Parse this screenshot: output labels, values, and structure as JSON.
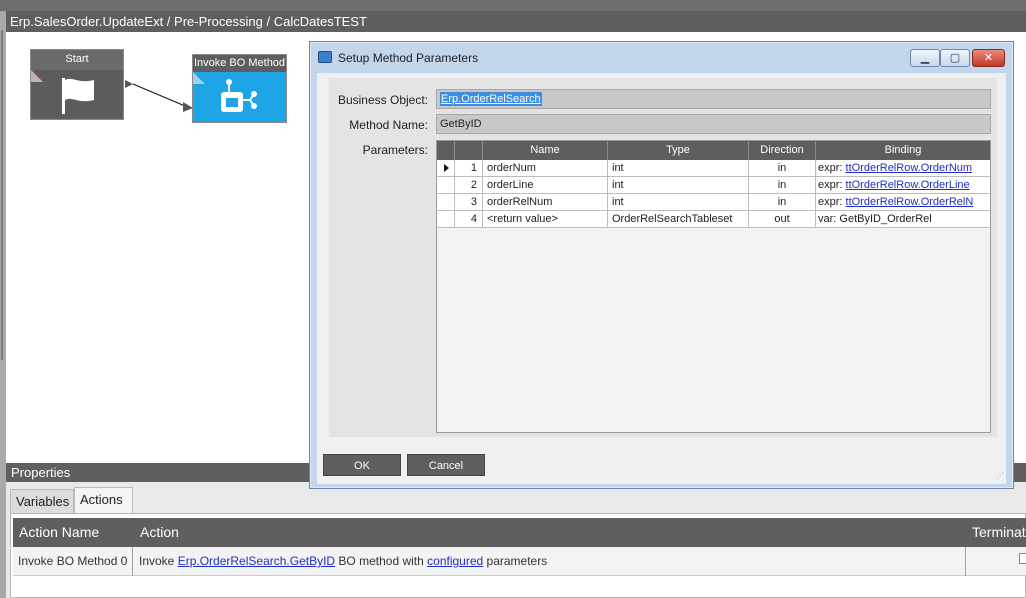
{
  "window": {
    "title": "Erp.SalesOrder.UpdateExt / Pre-Processing / CalcDatesTEST"
  },
  "canvas": {
    "start_node": {
      "label": "Start",
      "icon": "flag-icon"
    },
    "bo_node": {
      "label": "Invoke BO Method",
      "icon": "bo-method-icon"
    }
  },
  "dialog": {
    "title": "Setup Method Parameters",
    "business_object_label": "Business Object:",
    "business_object_value": "Erp.OrderRelSearch",
    "method_name_label": "Method Name:",
    "method_name_value": "GetByID",
    "parameters_label": "Parameters:",
    "columns": [
      "Name",
      "Type",
      "Direction",
      "Binding"
    ],
    "rows": [
      {
        "num": "1",
        "name": "orderNum",
        "type": "int",
        "direction": "in",
        "binding_prefix": "expr: ",
        "binding_link": "ttOrderRelRow.OrderNum"
      },
      {
        "num": "2",
        "name": "orderLine",
        "type": "int",
        "direction": "in",
        "binding_prefix": "expr: ",
        "binding_link": "ttOrderRelRow.OrderLine"
      },
      {
        "num": "3",
        "name": "orderRelNum",
        "type": "int",
        "direction": "in",
        "binding_prefix": "expr: ",
        "binding_link": "ttOrderRelRow.OrderRelN"
      },
      {
        "num": "4",
        "name": "<return value>",
        "type": "OrderRelSearchTableset",
        "direction": "out",
        "binding_prefix": "var: GetByID_OrderRel",
        "binding_link": ""
      }
    ],
    "ok_label": "OK",
    "cancel_label": "Cancel"
  },
  "properties": {
    "header": "Properties",
    "tabs": [
      "Variables",
      "Actions"
    ],
    "active_tab": "Actions",
    "columns": {
      "action_name": "Action Name",
      "action": "Action",
      "terminate": "Terminate"
    },
    "row": {
      "action_name": "Invoke BO Method 0",
      "action_pre": "Invoke ",
      "action_link": "Erp.OrderRelSearch.GetByID",
      "action_mid": " BO method with ",
      "action_link2": "configured",
      "action_post": " parameters"
    }
  },
  "colors": {
    "header_gray": "#5f5f5f",
    "node_blue": "#1ea5e6",
    "link_blue": "#1f2fc2",
    "selection_blue": "#3d8ee0",
    "dialog_frame": "#c4d6ec"
  }
}
